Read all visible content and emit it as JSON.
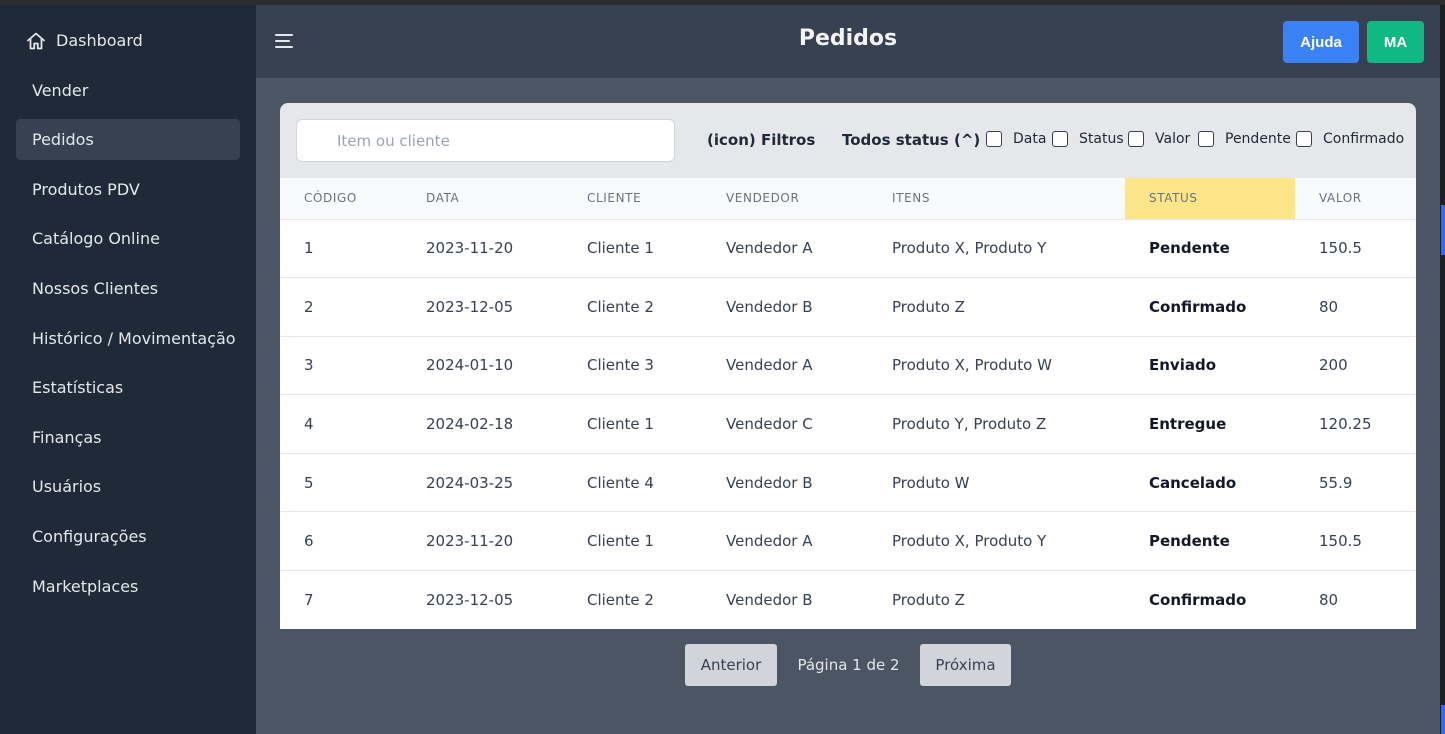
{
  "sidebar": {
    "items": [
      {
        "label": "Dashboard",
        "icon": "home-icon"
      },
      {
        "label": "Vender"
      },
      {
        "label": "Pedidos",
        "active": true
      },
      {
        "label": "Produtos PDV"
      },
      {
        "label": "Catálogo Online"
      },
      {
        "label": "Nossos Clientes"
      },
      {
        "label": "Histórico / Movimentação"
      },
      {
        "label": "Estatísticas"
      },
      {
        "label": "Finanças"
      },
      {
        "label": "Usuários"
      },
      {
        "label": "Configurações"
      },
      {
        "label": "Marketplaces"
      }
    ]
  },
  "header": {
    "title": "Pedidos",
    "help_label": "Ajuda",
    "user_initials": "MA"
  },
  "filters": {
    "search_placeholder": "Item ou cliente",
    "filters_label": "(icon) Filtros",
    "status_toggle": "Todos status (^)",
    "checkboxes": [
      "Data",
      "Status",
      "Valor",
      "Pendente",
      "Confirmado"
    ]
  },
  "table": {
    "columns": [
      "CÓDIGO",
      "DATA",
      "CLIENTE",
      "VENDEDOR",
      "ITENS",
      "STATUS",
      "VALOR"
    ],
    "highlighted_column": "STATUS",
    "rows": [
      [
        "1",
        "2023-11-20",
        "Cliente 1",
        "Vendedor A",
        "Produto X, Produto Y",
        "Pendente",
        "150.5"
      ],
      [
        "2",
        "2023-12-05",
        "Cliente 2",
        "Vendedor B",
        "Produto Z",
        "Confirmado",
        "80"
      ],
      [
        "3",
        "2024-01-10",
        "Cliente 3",
        "Vendedor A",
        "Produto X, Produto W",
        "Enviado",
        "200"
      ],
      [
        "4",
        "2024-02-18",
        "Cliente 1",
        "Vendedor C",
        "Produto Y, Produto Z",
        "Entregue",
        "120.25"
      ],
      [
        "5",
        "2024-03-25",
        "Cliente 4",
        "Vendedor B",
        "Produto W",
        "Cancelado",
        "55.9"
      ],
      [
        "6",
        "2023-11-20",
        "Cliente 1",
        "Vendedor A",
        "Produto X, Produto Y",
        "Pendente",
        "150.5"
      ],
      [
        "7",
        "2023-12-05",
        "Cliente 2",
        "Vendedor B",
        "Produto Z",
        "Confirmado",
        "80"
      ]
    ]
  },
  "pagination": {
    "prev_label": "Anterior",
    "info": "Página 1 de 2",
    "next_label": "Próxima"
  },
  "colors": {
    "sidebar_bg": "#1f2937",
    "main_bg": "#4b5563",
    "header_bg": "#374151",
    "help_button": "#3b82f6",
    "user_button": "#10b981",
    "status_highlight": "#fde68a"
  }
}
